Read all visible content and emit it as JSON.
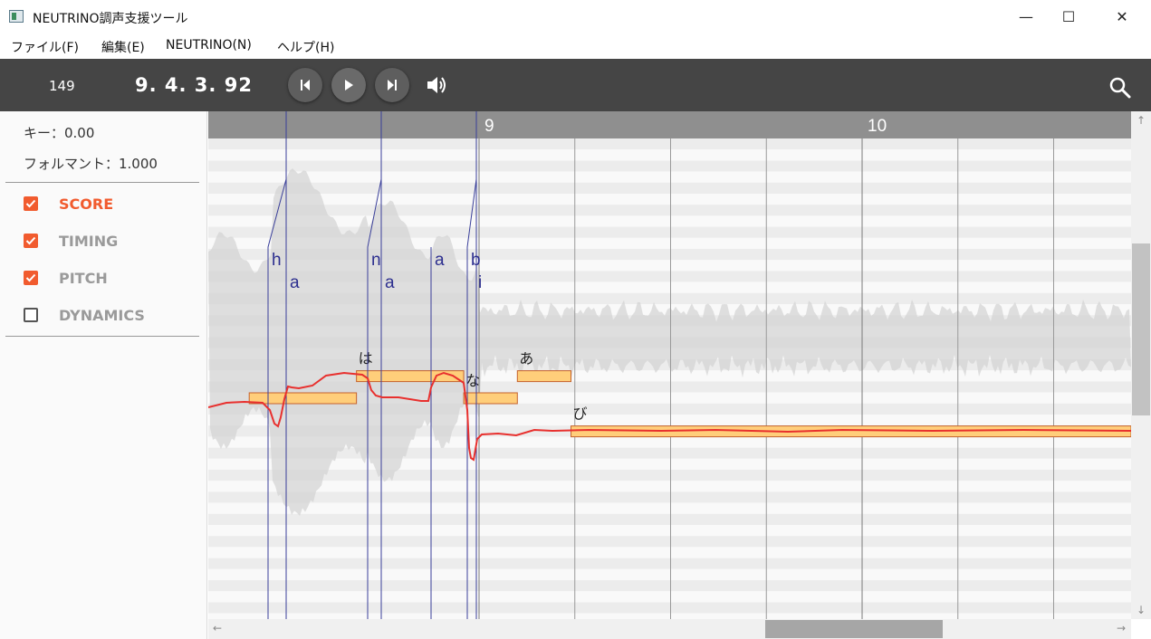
{
  "window": {
    "title": "NEUTRINO調声支援ツール",
    "minimize": "—",
    "maximize": "☐",
    "close": "✕"
  },
  "menu": {
    "items": [
      "ファイル(F)",
      "編集(E)",
      "NEUTRINO(N)",
      "ヘルプ(H)"
    ]
  },
  "toolbar": {
    "tempo": "149",
    "position": "9. 4. 3. 92",
    "icons": [
      "skip-previous-icon",
      "play-icon",
      "skip-next-icon",
      "volume-icon",
      "search-icon"
    ]
  },
  "sidebar": {
    "key_label": "キー：0.00",
    "formant_label": "フォルマント：1.000",
    "tracks": [
      {
        "label": "SCORE",
        "checked": true,
        "color": "#f15b2e"
      },
      {
        "label": "TIMING",
        "checked": true,
        "color": "#9a9a9a"
      },
      {
        "label": "PITCH",
        "checked": true,
        "color": "#9a9a9a"
      },
      {
        "label": "DYNAMICS",
        "checked": false,
        "color": "#9a9a9a"
      }
    ]
  },
  "editor": {
    "measures": [
      {
        "label": "9"
      },
      {
        "label": "10"
      }
    ],
    "notes": [
      {
        "lyric": "",
        "start": 8.4,
        "end": 8.68,
        "pitch": "C4"
      },
      {
        "lyric": "は",
        "start": 8.68,
        "end": 8.96,
        "pitch": "D4"
      },
      {
        "lyric": "な",
        "start": 8.96,
        "end": 9.1,
        "pitch": "C4"
      },
      {
        "lyric": "あ",
        "start": 9.1,
        "end": 9.24,
        "pitch": "D4"
      },
      {
        "lyric": "び",
        "start": 9.24,
        "end": 11.2,
        "pitch": "A3"
      }
    ],
    "phonemes": [
      "h",
      "a",
      "n",
      "a",
      "a",
      "b",
      "i"
    ],
    "playhead_measure": 10.76,
    "colors": {
      "note_fill": "#ffce7a",
      "note_border": "#c4622d",
      "pitch_curve": "#e8302e",
      "timing_line": "#3a3f9a",
      "playhead": "#e33a2a"
    }
  },
  "scrollbars": {
    "up": "↑",
    "down": "↓",
    "left": "←",
    "right": "→"
  }
}
